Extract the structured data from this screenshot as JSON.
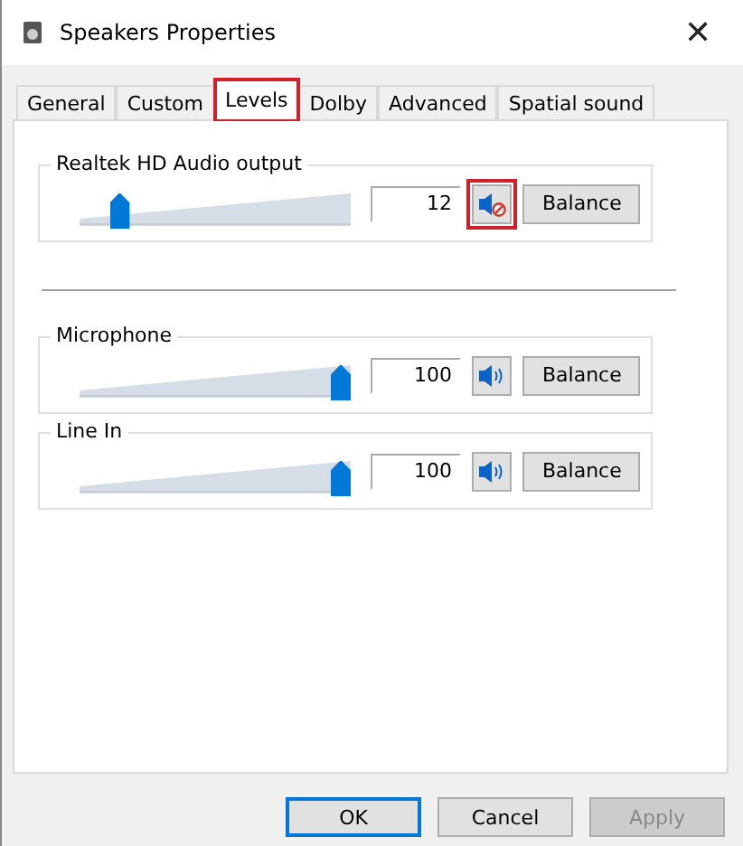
{
  "window": {
    "title": "Speakers Properties",
    "close": "✕"
  },
  "tabs": [
    {
      "label": "General",
      "selected": false,
      "highlighted": false
    },
    {
      "label": "Custom",
      "selected": false,
      "highlighted": false
    },
    {
      "label": "Levels",
      "selected": true,
      "highlighted": true
    },
    {
      "label": "Dolby",
      "selected": false,
      "highlighted": false
    },
    {
      "label": "Advanced",
      "selected": false,
      "highlighted": false
    },
    {
      "label": "Spatial sound",
      "selected": false,
      "highlighted": false
    }
  ],
  "output": {
    "name": "Realtek HD Audio output",
    "level": 0.12,
    "value": "12",
    "muted": true,
    "highlighted": true,
    "balance": "Balance"
  },
  "inputs": [
    {
      "name": "Microphone",
      "level": 1,
      "value": "100",
      "muted": false,
      "highlighted": false,
      "balance": "Balance"
    },
    {
      "name": "Line In",
      "level": 1,
      "value": "100",
      "muted": false,
      "highlighted": false,
      "balance": "Balance"
    }
  ],
  "buttons": [
    {
      "label": "OK",
      "default": true,
      "disabled": false
    },
    {
      "label": "Cancel",
      "default": false,
      "disabled": false
    },
    {
      "label": "Apply",
      "default": false,
      "disabled": true
    }
  ]
}
